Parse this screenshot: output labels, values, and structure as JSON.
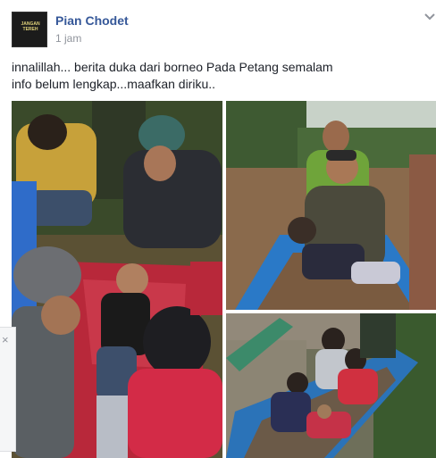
{
  "post": {
    "author": "Pian Chodet",
    "timestamp": "1 jam",
    "avatar_text": "JANGAN TEREH",
    "message_line1": "innalillah... berita duka dari borneo Pada Petang semalam",
    "message_line2": "info belum lengkap...maafkan diriku.."
  },
  "photos": [
    {
      "scene": "child-lying-on-mat-surrounded-by-people"
    },
    {
      "scene": "man-holding-child-in-boat-on-river"
    },
    {
      "scene": "women-in-boat-with-child"
    }
  ],
  "side_panel": {
    "close_glyph": "×"
  },
  "colors": {
    "link": "#365899",
    "text": "#1d2129",
    "meta": "#90949c"
  }
}
